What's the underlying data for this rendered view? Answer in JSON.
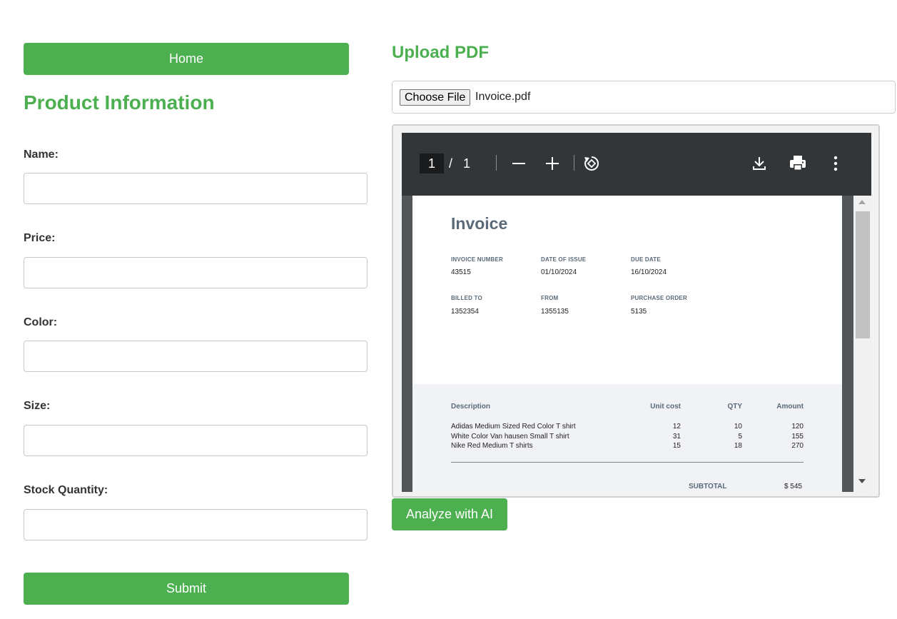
{
  "nav": {
    "home_label": "Home"
  },
  "form": {
    "title": "Product Information",
    "fields": [
      {
        "label": "Name:",
        "value": ""
      },
      {
        "label": "Price:",
        "value": ""
      },
      {
        "label": "Color:",
        "value": ""
      },
      {
        "label": "Size:",
        "value": ""
      },
      {
        "label": "Stock Quantity:",
        "value": ""
      }
    ],
    "submit_label": "Submit"
  },
  "upload": {
    "title": "Upload PDF",
    "choose_label": "Choose File",
    "file_name": "Invoice.pdf",
    "analyze_label": "Analyze with AI"
  },
  "viewer": {
    "current_page": "1",
    "separator": "/",
    "total_pages": "1",
    "icons": [
      "zoom-out-icon",
      "zoom-in-icon",
      "rotate-icon",
      "download-icon",
      "print-icon",
      "more-options-icon"
    ]
  },
  "invoice": {
    "title": "Invoice",
    "invoice_number_label": "INVOICE NUMBER",
    "invoice_number": "43515",
    "date_of_issue_label": "DATE OF ISSUE",
    "date_of_issue": "01/10/2024",
    "due_date_label": "DUE DATE",
    "due_date": "16/10/2024",
    "billed_to_label": "BILLED TO",
    "billed_to": "1352354",
    "from_label": "FROM",
    "from": "1355135",
    "purchase_order_label": "PURCHASE ORDER",
    "purchase_order": "5135",
    "columns": [
      "Description",
      "Unit cost",
      "QTY",
      "Amount"
    ],
    "items": [
      {
        "description": "Adidas Medium Sized Red Color T shirt",
        "unit_cost": "12",
        "qty": "10",
        "amount": "120"
      },
      {
        "description": "White Color Van hausen Small T shirt",
        "unit_cost": "31",
        "qty": "5",
        "amount": "155"
      },
      {
        "description": "Nike Red Medium T shirts",
        "unit_cost": "15",
        "qty": "18",
        "amount": "270"
      }
    ],
    "subtotal_label": "SUBTOTAL",
    "subtotal": "$ 545"
  },
  "colors": {
    "accent": "#4caf50",
    "toolbar": "#323639"
  }
}
